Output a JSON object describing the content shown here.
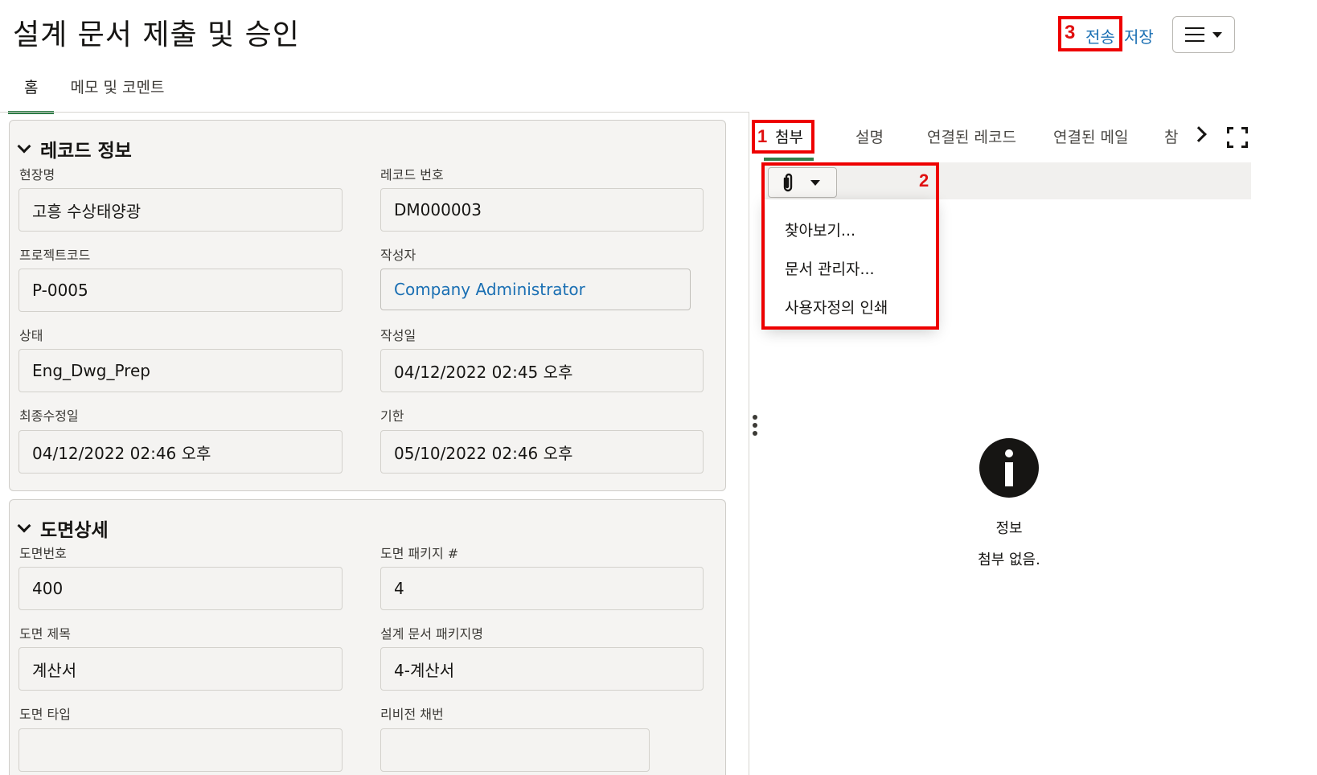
{
  "header": {
    "title": "설계 문서 제출 및 승인",
    "send_label": "전송",
    "save_label": "저장"
  },
  "main_tabs": [
    {
      "label": "홈",
      "active": true
    },
    {
      "label": "메모 및 코멘트",
      "active": false
    }
  ],
  "record_info": {
    "title": "레코드 정보",
    "fields": {
      "site_name": {
        "label": "현장명",
        "value": "고흥 수상태양광"
      },
      "record_no": {
        "label": "레코드 번호",
        "value": "DM000003"
      },
      "project_code": {
        "label": "프로젝트코드",
        "value": "P-0005"
      },
      "author": {
        "label": "작성자",
        "value": "Company Administrator"
      },
      "status": {
        "label": "상태",
        "value": "Eng_Dwg_Prep"
      },
      "created": {
        "label": "작성일",
        "value": "04/12/2022 02:45 오후"
      },
      "modified": {
        "label": "최종수정일",
        "value": "04/12/2022 02:46 오후"
      },
      "due": {
        "label": "기한",
        "value": "05/10/2022 02:46 오후"
      }
    }
  },
  "drawing_detail": {
    "title": "도면상세",
    "fields": {
      "drawing_no": {
        "label": "도면번호",
        "value": "400"
      },
      "package_no": {
        "label": "도면 패키지 #",
        "value": "4"
      },
      "drawing_title": {
        "label": "도면 제목",
        "value": "계산서"
      },
      "package_name": {
        "label": "설계 문서 패키지명",
        "value": "4-계산서"
      },
      "drawing_type": {
        "label": "도면 타입",
        "value": ""
      },
      "revision": {
        "label": "리비전 채번",
        "value": ""
      }
    }
  },
  "side_tabs": [
    {
      "label": "첨부",
      "active": true
    },
    {
      "label": "설명"
    },
    {
      "label": "연결된 레코드"
    },
    {
      "label": "연결된 메일"
    },
    {
      "label": "참"
    }
  ],
  "attach_menu": {
    "items": [
      "찾아보기...",
      "문서 관리자...",
      "사용자정의 인쇄"
    ]
  },
  "empty_state": {
    "title": "정보",
    "message": "첨부 없음."
  },
  "annotations": {
    "one": "1",
    "two": "2",
    "three": "3"
  },
  "colors": {
    "accent_green": "#2e7d47",
    "link_blue": "#1a6fb3",
    "annotation_red": "#ee0000"
  }
}
